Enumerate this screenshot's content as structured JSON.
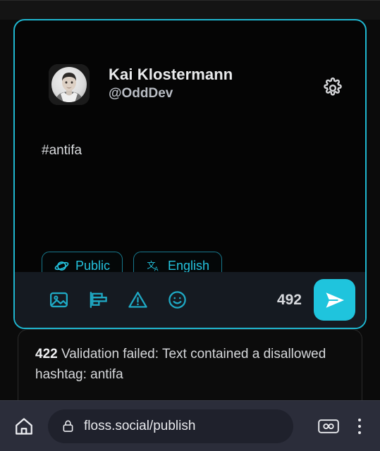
{
  "browser": {
    "url": "floss.social/publish",
    "home_icon": "home-icon",
    "lock_icon": "lock-icon",
    "tabs_icon": "tab-count-icon",
    "menu_icon": "overflow-menu-icon"
  },
  "composer": {
    "author": {
      "display_name": "Kai Klostermann",
      "handle": "@OddDev",
      "avatar_icon": "user-avatar-photo"
    },
    "settings_icon": "gear-icon",
    "text": "#antifa",
    "chips": [
      {
        "label": "Public",
        "icon": "globe-planet-icon"
      },
      {
        "label": "English",
        "icon": "translate-icon"
      }
    ],
    "toolbar": {
      "tools": [
        {
          "name": "add-image-button",
          "icon": "image-icon"
        },
        {
          "name": "add-poll-button",
          "icon": "poll-icon"
        },
        {
          "name": "content-warning-button",
          "icon": "warning-triangle-icon"
        },
        {
          "name": "emoji-button",
          "icon": "emoji-smiley-icon"
        }
      ],
      "char_count": "492",
      "send_icon": "send-paper-plane-icon"
    }
  },
  "error": {
    "code": "422",
    "message": "Validation failed: Text contained a disallowed hashtag: antifa"
  },
  "colors": {
    "accent": "#1fc4dd",
    "card_border": "#1fb6cf",
    "chip_text": "#24c2dd",
    "toolbar_bg": "#151a21",
    "browser_bg": "#2b2d3a"
  }
}
